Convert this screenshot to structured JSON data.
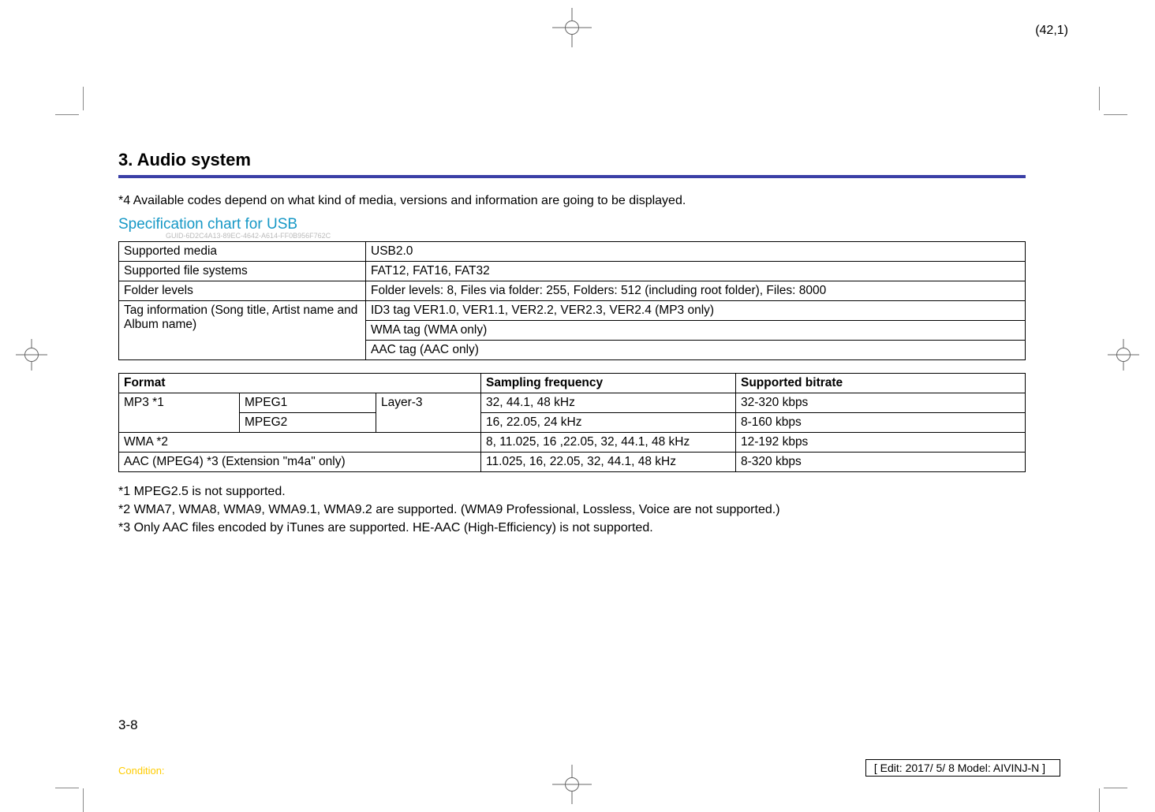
{
  "coord": "(42,1)",
  "section_number": "3.",
  "section_title": "Audio system",
  "accent_color": "#3a3fa6",
  "intro_note": "*4 Available codes depend on what kind of media, versions and information are going to be displayed.",
  "sub_heading": "Specification chart for USB",
  "guid": "GUID-6D2C4A13-89EC-4642-A614-FF0B956F762C",
  "spec_table": {
    "rows": [
      {
        "label": "Supported media",
        "value": "USB2.0"
      },
      {
        "label": "Supported file systems",
        "value": "FAT12, FAT16, FAT32"
      },
      {
        "label": "Folder levels",
        "value": "Folder levels: 8, Files via folder: 255, Folders: 512 (including root folder), Files: 8000"
      }
    ],
    "tag_label": "Tag information (Song title, Artist name and Album name)",
    "tag_values": [
      "ID3 tag VER1.0, VER1.1, VER2.2, VER2.3, VER2.4 (MP3 only)",
      "WMA tag (WMA only)",
      "AAC tag (AAC only)"
    ]
  },
  "format_table": {
    "headers": {
      "format": "Format",
      "sampling": "Sampling frequency",
      "bitrate": "Supported bitrate"
    },
    "mp3_label": "MP3 *1",
    "mp3_codec1": "MPEG1",
    "mp3_codec2": "MPEG2",
    "mp3_layer": "Layer-3",
    "mp3_row1_sampling": "32, 44.1, 48 kHz",
    "mp3_row1_bitrate": "32-320 kbps",
    "mp3_row2_sampling": "16, 22.05, 24 kHz",
    "mp3_row2_bitrate": "8-160 kbps",
    "wma_label": "WMA *2",
    "wma_sampling": "8, 11.025, 16 ,22.05, 32, 44.1, 48 kHz",
    "wma_bitrate": "12-192 kbps",
    "aac_label": "AAC (MPEG4) *3 (Extension \"m4a\" only)",
    "aac_sampling": "11.025, 16, 22.05, 32, 44.1, 48 kHz",
    "aac_bitrate": "8-320 kbps"
  },
  "footnotes": [
    "*1 MPEG2.5 is not supported.",
    "*2 WMA7, WMA8, WMA9, WMA9.1, WMA9.2 are supported. (WMA9 Professional, Lossless, Voice are not supported.)",
    "*3 Only AAC files encoded by iTunes are supported. HE-AAC (High-Efficiency) is not supported."
  ],
  "page_number": "3-8",
  "condition_label": "Condition:",
  "edit_info": "[ Edit: 2017/ 5/ 8   Model: AIVINJ-N ]"
}
